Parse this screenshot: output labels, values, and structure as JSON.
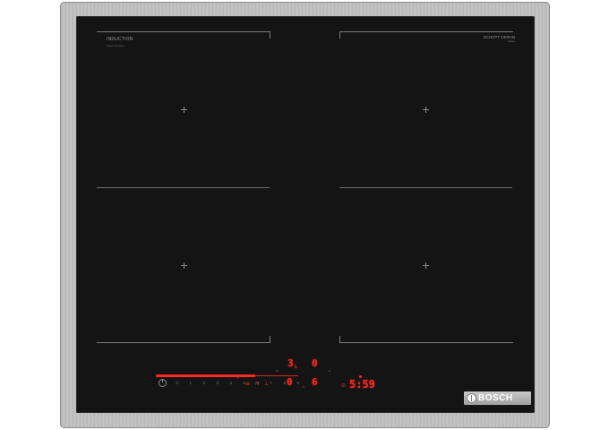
{
  "cooktop": {
    "label_top_left": "INDUCTION",
    "label_top_left_sub": "Flexinduction",
    "label_top_right": "SCHOTT CERAN",
    "label_top_right_sub": "Glass",
    "brand": "BOSCH"
  },
  "display": {
    "level_zone_a": "3",
    "level_zone_a_suffix": "L",
    "level_zone_b": "0",
    "level_zone_c": "0",
    "level_zone_d": "6",
    "timer": "5:59"
  },
  "slider": {
    "ticks": [
      "0",
      "1",
      "2",
      "3",
      "4",
      "5",
      "6",
      "7",
      "8",
      "9"
    ],
    "level_fraction": 0.7
  },
  "colors": {
    "glass": "#141414",
    "display_red": "#ff2a1f",
    "frame": "#bdbdbd"
  }
}
